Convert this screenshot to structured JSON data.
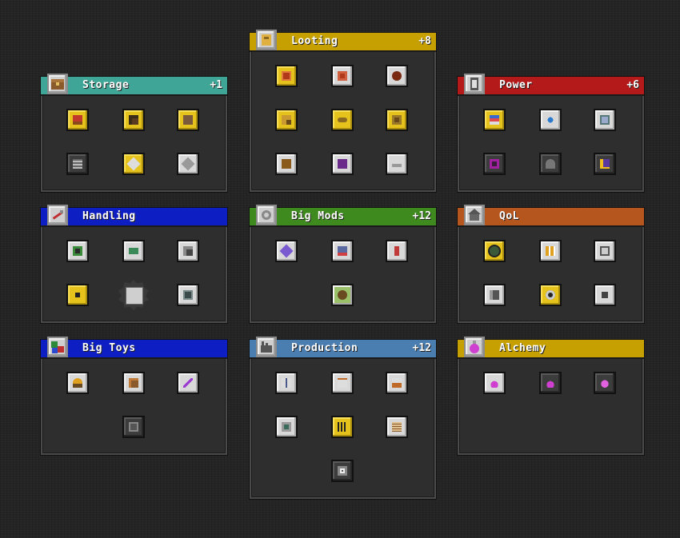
{
  "panels": [
    {
      "title": "Storage",
      "count": "+1",
      "color": "#3fa596",
      "icon": "storage-icon"
    },
    {
      "title": "Looting",
      "count": "+8",
      "color": "#c5a000",
      "icon": "looting-icon"
    },
    {
      "title": "Power",
      "count": "+6",
      "color": "#b51a1a",
      "icon": "power-icon"
    },
    {
      "title": "Handling",
      "count": "",
      "color": "#0d1fc2",
      "icon": "handling-icon"
    },
    {
      "title": "Big Mods",
      "count": "+12",
      "color": "#3f8a1e",
      "icon": "big-mods-icon"
    },
    {
      "title": "QoL",
      "count": "",
      "color": "#b5561e",
      "icon": "qol-icon"
    },
    {
      "title": "Big Toys",
      "count": "",
      "color": "#0d1fc2",
      "icon": "big-toys-icon"
    },
    {
      "title": "Production",
      "count": "+12",
      "color": "#4a7db0",
      "icon": "production-icon"
    },
    {
      "title": "Alchemy",
      "count": "",
      "color": "#c5a000",
      "icon": "alchemy-icon"
    }
  ]
}
